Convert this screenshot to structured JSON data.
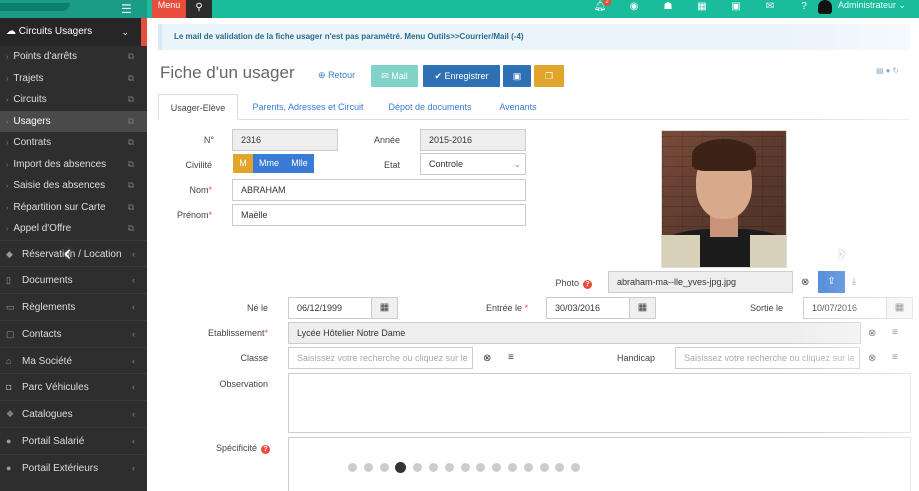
{
  "topbar": {
    "menu_label": "Menu",
    "notification_count": "2",
    "user_name": "Administrateur",
    "icons": [
      "bell-icon",
      "globe-icon",
      "users-icon",
      "map-icon",
      "bus-icon",
      "envelope-icon",
      "help-icon"
    ]
  },
  "sidebar": {
    "section_title": "Circuits Usagers",
    "items": [
      {
        "label": "Points d'arrêts"
      },
      {
        "label": "Trajets"
      },
      {
        "label": "Circuits"
      },
      {
        "label": "Usagers"
      },
      {
        "label": "Contrats"
      },
      {
        "label": "Import des absences"
      },
      {
        "label": "Saisie des absences"
      },
      {
        "label": "Répartition sur Carte"
      },
      {
        "label": "Appel d'Offre"
      }
    ],
    "groups": [
      {
        "label": "Réservation / Location"
      },
      {
        "label": "Documents"
      },
      {
        "label": "Règlements"
      },
      {
        "label": "Contacts"
      },
      {
        "label": "Ma Société"
      },
      {
        "label": "Parc Véhicules"
      },
      {
        "label": "Catalogues"
      },
      {
        "label": "Portail Salarié"
      },
      {
        "label": "Portail Extérieurs"
      }
    ]
  },
  "alert": {
    "text": "Le mail de validation de la fiche usager n'est pas paramétré. Menu Outils>>Courrier/Mail (-4)"
  },
  "page": {
    "title": "Fiche d'un usager",
    "retour_label": "Retour",
    "mail_label": "Mail",
    "save_label": "Enregistrer"
  },
  "tabs": [
    {
      "label": "Usager-Elève"
    },
    {
      "label": "Parents, Adresses et Circuit"
    },
    {
      "label": "Dépot de documents"
    },
    {
      "label": "Avenants"
    }
  ],
  "form": {
    "numero_label": "N°",
    "numero_value": "2316",
    "annee_label": "Année",
    "annee_value": "2015-2016",
    "civilite_label": "Civilité",
    "civilite_options": [
      "M",
      "Mme",
      "Mlle"
    ],
    "etat_label": "Etat",
    "etat_value": "Controle",
    "nom_label": "Nom",
    "nom_value": "ABRAHAM",
    "prenom_label": "Prénom",
    "prenom_value": "Maëlle",
    "photo_label": "Photo",
    "photo_filename": "abraham-ma--lle_yves-jpg.jpg",
    "ne_le_label": "Né le",
    "ne_le_value": "06/12/1999",
    "entree_label": "Entrée le",
    "entree_value": "30/03/2016",
    "sortie_label": "Sortie le",
    "sortie_value": "10/07/2016",
    "etablissement_label": "Etablissement",
    "etablissement_value": "Lycée Hôtelier Notre Dame",
    "classe_label": "Classe",
    "classe_placeholder": "Saisissez votre recherche ou cliquez sur le",
    "handicap_label": "Handicap",
    "handicap_placeholder": "Saisissez votre recherche ou cliquez sur le",
    "observation_label": "Observation",
    "specificite_label": "Spécificité"
  },
  "pagination": {
    "total": 15,
    "active_index": 3
  },
  "colors": {
    "topbar": "#1abc9c",
    "menu": "#e74c3c",
    "primary": "#2f6fb3",
    "mail": "#7fd3c9",
    "warning": "#e0a52a",
    "civ_m": "#e0a52a",
    "civ_other": "#3a7bd5"
  }
}
